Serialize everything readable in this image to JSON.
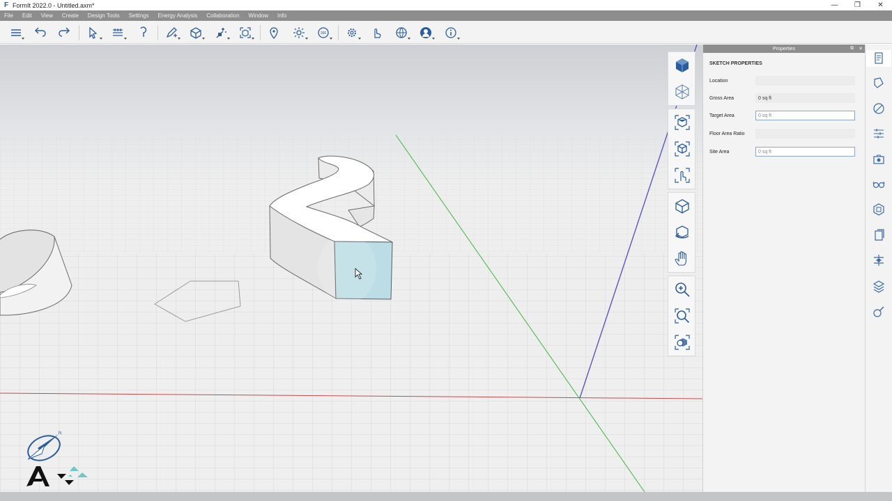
{
  "window": {
    "title": "FormIt 2022.0 - Untitled.axm*",
    "controls": [
      "—",
      "❐",
      "✕"
    ]
  },
  "menu": [
    "File",
    "Edit",
    "View",
    "Create",
    "Design Tools",
    "Settings",
    "Energy Analysis",
    "Collaboration",
    "Window",
    "Info"
  ],
  "toolbar": {
    "icons": [
      "layers-icon",
      "undo-icon",
      "redo-icon",
      "select-icon",
      "tape-measure-icon",
      "paint-icon",
      "draw-pen-icon",
      "cube-icon",
      "magic-wand-icon",
      "group-icon",
      "location-pin-icon",
      "sun-icon",
      "scene-360-icon",
      "gear-icon",
      "hand-pointer-icon",
      "globe-icon",
      "user-icon",
      "info-icon"
    ]
  },
  "viewbar": {
    "groups": [
      [
        "view-cube-solid-icon",
        "view-cube-wire-icon"
      ],
      [
        "view-top-icon",
        "view-front-icon",
        "touch-gesture-icon"
      ],
      [
        "orbit-icon",
        "look-around-icon",
        "pan-hand-icon"
      ],
      [
        "zoom-icon",
        "zoom-window-icon",
        "zoom-extents-icon"
      ]
    ]
  },
  "properties": {
    "header": "Properties",
    "section": "SKETCH PROPERTIES",
    "rows": [
      {
        "label": "Location",
        "value": "",
        "editable": false
      },
      {
        "label": "Gross Area",
        "value": "0 sq ft",
        "editable": false
      },
      {
        "label": "Target Area",
        "value": "0 sq ft",
        "editable": true
      },
      {
        "label": "Floor Area Ratio",
        "value": "",
        "editable": false
      },
      {
        "label": "Site Area",
        "value": "0 sq ft",
        "editable": true
      }
    ]
  },
  "rightbar": {
    "icons": [
      "properties-panel-icon",
      "materials-icon",
      "layers-panel-icon",
      "levels-icon",
      "scenes-icon",
      "styles-icon",
      "groups-icon",
      "content-library-icon",
      "plugins-icon",
      "dynamo-icon",
      "visual-styles-icon"
    ]
  },
  "colors": {
    "selected_face": "#bcdde6",
    "accent": "#1e5aa8",
    "x_axis": "#c24b4b",
    "y_axis": "#3fb53f",
    "z_axis": "#5a55c8"
  }
}
